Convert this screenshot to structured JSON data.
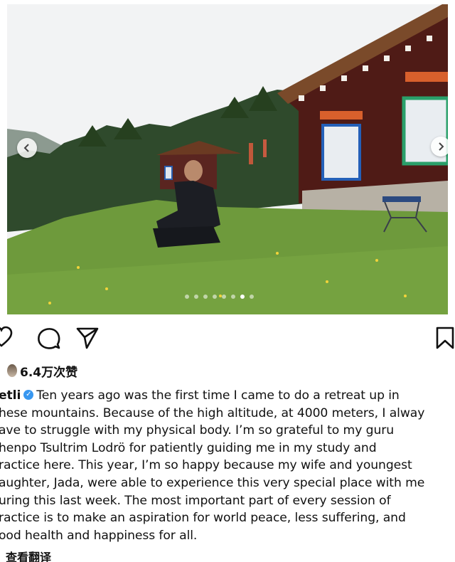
{
  "post": {
    "photo": {
      "description_icon": "photo-carousel",
      "dot_count": 8,
      "active_dot": 6
    },
    "actions": {
      "like_icon": "heart-icon",
      "comment_icon": "comment-icon",
      "share_icon": "share-icon",
      "save_icon": "bookmark-icon"
    },
    "likes": {
      "text": "6.4万次赞"
    },
    "caption": {
      "username": "etli",
      "lines": [
        "Ten years ago was the first time I came to do a retreat up in",
        "hese mountains. Because of the high altitude, at 4000 meters, I alway",
        "ave to struggle with my physical body. I’m so grateful to my guru",
        "henpo Tsultrim Lodrö for patiently guiding me in my study and",
        "ractice here. This year, I’m so happy because my wife and youngest",
        "aughter, Jada, were able to experience this very special place with me",
        "uring this last week. The most important part of every session of",
        "ractice is to make an aspiration for world peace, less suffering, and",
        "ood health and happiness for all."
      ]
    },
    "translate_label": "查看翻译"
  },
  "colors": {
    "verified": "#3897f0",
    "text": "#111111"
  }
}
